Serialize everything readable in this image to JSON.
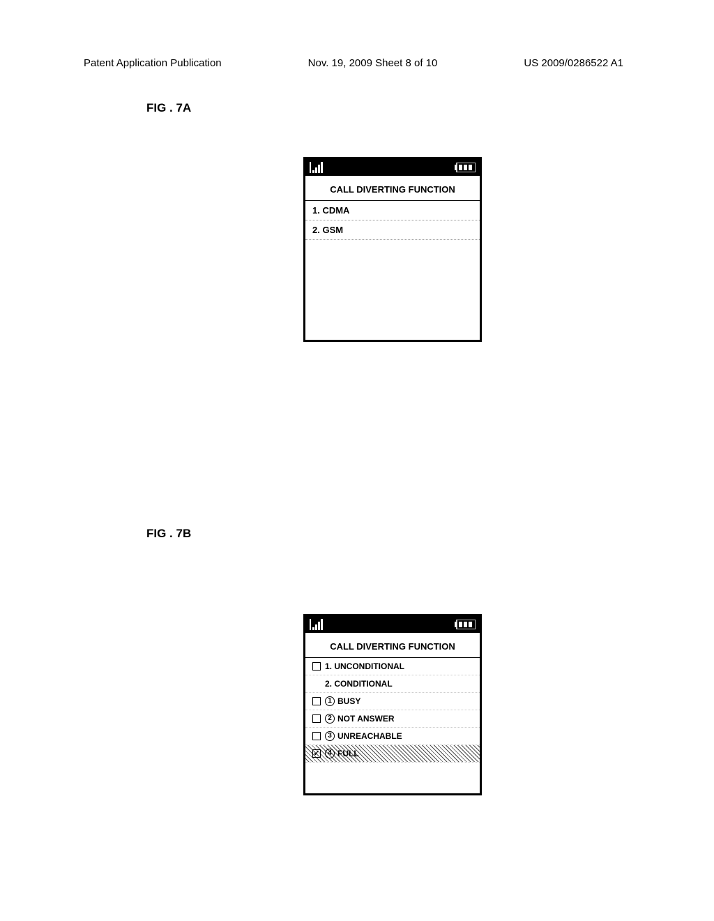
{
  "header": {
    "left": "Patent Application Publication",
    "center": "Nov. 19, 2009  Sheet 8 of 10",
    "right": "US 2009/0286522 A1"
  },
  "fig7a": {
    "label": "FIG . 7A",
    "title": "CALL DIVERTING FUNCTION",
    "items": [
      "1.   CDMA",
      "2.   GSM"
    ]
  },
  "fig7b": {
    "label": "FIG . 7B",
    "title": "CALL DIVERTING FUNCTION",
    "item1": "1.   UNCONDITIONAL",
    "item2": "2.   CONDITIONAL",
    "sub1": "BUSY",
    "sub2": "NOT ANSWER",
    "sub3": "UNREACHABLE",
    "sub4": "FULL",
    "num1": "1",
    "num2": "2",
    "num3": "3",
    "num4": "4"
  }
}
